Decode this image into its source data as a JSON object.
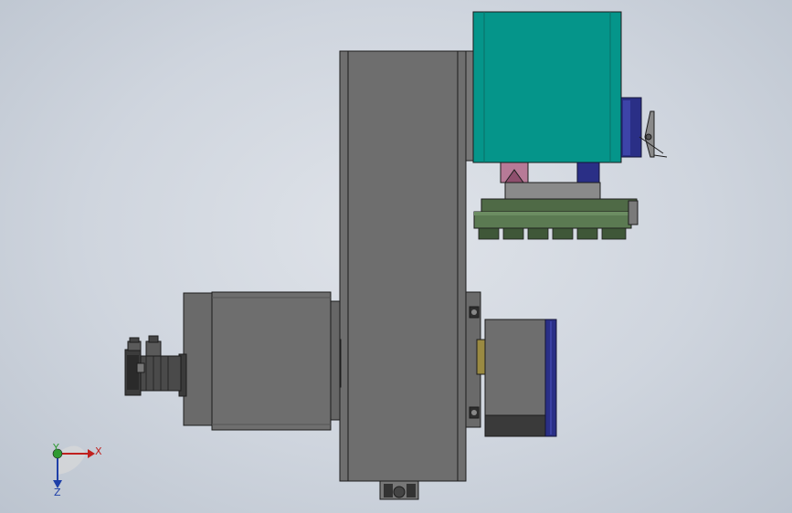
{
  "axes": {
    "x_label": "X",
    "y_label": "Y",
    "z_label": "Z",
    "x_color": "#c0201e",
    "y_color": "#2f9a32",
    "z_color": "#1e3fa8"
  },
  "colors": {
    "background": "#d3d9e1",
    "body_gray": "#6e6e6e",
    "body_dark": "#5a5a5a",
    "edge": "#1c1c1c",
    "teal": "#05958a",
    "navy": "#2a2f86",
    "green": "#4f6a46",
    "pink": "#b77a97",
    "gold": "#9a8a42"
  }
}
